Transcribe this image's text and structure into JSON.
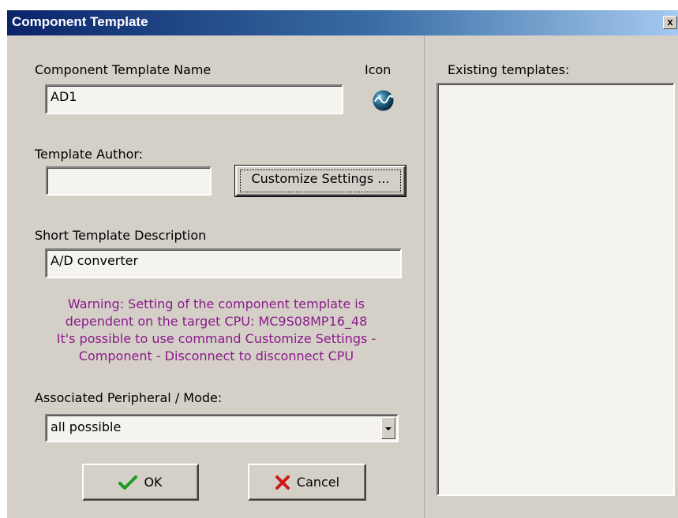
{
  "window": {
    "title": "Component Template",
    "close_label": "x"
  },
  "form": {
    "name_label": "Component Template Name",
    "name_value": "AD1",
    "icon_label": "Icon",
    "icon_name": "component-globe-icon",
    "author_label": "Template Author:",
    "author_value": "",
    "customize_label": "Customize Settings ...",
    "description_label": "Short Template Description",
    "description_value": "A/D converter",
    "warning_lines": [
      "Warning: Setting of the component template is",
      "dependent on the target CPU: MC9S08MP16_48",
      "It's possible to use command Customize Settings -",
      "Component - Disconnect to disconnect CPU"
    ],
    "peripheral_label": "Associated Peripheral / Mode:",
    "peripheral_value": "all possible"
  },
  "buttons": {
    "ok_label": "OK",
    "cancel_label": "Cancel"
  },
  "templates": {
    "label": "Existing templates:"
  },
  "colors": {
    "dialog_bg": "#d4d0c8",
    "title_start": "#0a246a",
    "title_end": "#a6caf0",
    "warning_text": "#8b1a8b"
  }
}
